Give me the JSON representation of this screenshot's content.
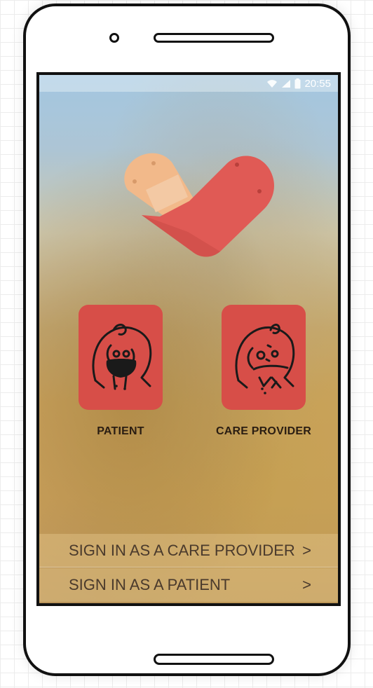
{
  "status_bar": {
    "time": "20:55",
    "icons": [
      "wifi-icon",
      "signal-icon",
      "battery-icon"
    ]
  },
  "logo": {
    "icon": "bandaged-heart-logo"
  },
  "roles": [
    {
      "label": "PATIENT",
      "icon": "masked-patient-icon"
    },
    {
      "label": "CARE PROVIDER",
      "icon": "care-provider-icon"
    }
  ],
  "signin": {
    "care_provider": {
      "label": "SIGN IN AS A CARE PROVIDER",
      "chevron": ">"
    },
    "patient": {
      "label": "SIGN IN AS A PATIENT",
      "chevron": ">"
    }
  },
  "colors": {
    "accent": "#d74e48",
    "logo_tan": "#f2b98a",
    "label_text": "#2a1d12",
    "row_text": "#4a3a2c"
  }
}
